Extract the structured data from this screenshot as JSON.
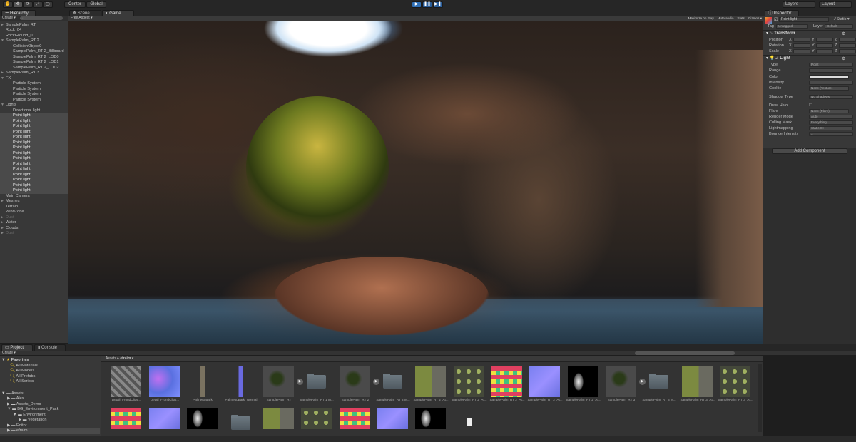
{
  "toolbar": {
    "tools": [
      "hand-tool",
      "move-tool",
      "rotate-tool",
      "scale-tool",
      "rect-tool"
    ],
    "pivot": "Center",
    "space": "Global",
    "play": "▶",
    "pause": "❚❚",
    "step": "▶❚",
    "layers": "Layers",
    "layout": "Layout"
  },
  "hierarchy": {
    "tab": "Hierarchy",
    "create": "Create ▾",
    "search_placeholder": "All",
    "items": [
      {
        "label": "SamplePalm_RT",
        "indent": 0,
        "arrow": true
      },
      {
        "label": "Rock_04",
        "indent": 0
      },
      {
        "label": "RockGround_01",
        "indent": 0
      },
      {
        "label": "SamplePalm_RT 2",
        "indent": 0,
        "arrow": true,
        "open": true
      },
      {
        "label": "CollisionObject0",
        "indent": 1
      },
      {
        "label": "SamplePalm_RT 2_Billboard",
        "indent": 1
      },
      {
        "label": "SamplePalm_RT 2_LOD0",
        "indent": 1
      },
      {
        "label": "SamplePalm_RT 2_LOD1",
        "indent": 1
      },
      {
        "label": "SamplePalm_RT 2_LOD2",
        "indent": 1
      },
      {
        "label": "SamplePalm_RT 3",
        "indent": 0,
        "arrow": true
      },
      {
        "label": "FX",
        "indent": 0,
        "arrow": true,
        "open": true
      },
      {
        "label": "Particle System",
        "indent": 1
      },
      {
        "label": "Particle System",
        "indent": 1
      },
      {
        "label": "Particle System",
        "indent": 1
      },
      {
        "label": "Particle System",
        "indent": 1
      },
      {
        "label": "Lights",
        "indent": 0,
        "arrow": true,
        "open": true
      },
      {
        "label": "Directional light",
        "indent": 1
      },
      {
        "label": "Point light",
        "indent": 1,
        "sel": true
      },
      {
        "label": "Point light",
        "indent": 1,
        "sel": true
      },
      {
        "label": "Point light",
        "indent": 1,
        "sel": true
      },
      {
        "label": "Point light",
        "indent": 1,
        "sel": true
      },
      {
        "label": "Point light",
        "indent": 1,
        "sel": true
      },
      {
        "label": "Point light",
        "indent": 1,
        "sel": true
      },
      {
        "label": "Point light",
        "indent": 1,
        "sel": true
      },
      {
        "label": "Point light",
        "indent": 1,
        "sel": true
      },
      {
        "label": "Point light",
        "indent": 1,
        "sel": true
      },
      {
        "label": "Point light",
        "indent": 1,
        "sel": true
      },
      {
        "label": "Point light",
        "indent": 1,
        "sel": true
      },
      {
        "label": "Point light",
        "indent": 1,
        "sel": true
      },
      {
        "label": "Point light",
        "indent": 1,
        "sel": true
      },
      {
        "label": "Point light",
        "indent": 1,
        "sel": true
      },
      {
        "label": "Point light",
        "indent": 1,
        "sel": true
      },
      {
        "label": "Main Camera",
        "indent": 0
      },
      {
        "label": "Meshes",
        "indent": 0,
        "arrow": true
      },
      {
        "label": "Terrain",
        "indent": 0
      },
      {
        "label": "WindZone",
        "indent": 0
      },
      {
        "label": "Dust",
        "indent": 0,
        "arrow": true,
        "dim": true
      },
      {
        "label": "Water",
        "indent": 0,
        "arrow": true
      },
      {
        "label": "Clouds",
        "indent": 0,
        "arrow": true
      },
      {
        "label": "Dust",
        "indent": 0,
        "arrow": true,
        "dim": true
      }
    ]
  },
  "view": {
    "tabs": [
      "Scene",
      "Game"
    ],
    "active": "Game",
    "aspect": "Free Aspect ▾",
    "options": [
      "Maximize on Play",
      "Mute audio",
      "Stats",
      "Gizmos ▾"
    ]
  },
  "inspector": {
    "tab": "Inspector",
    "object_name": "Point light",
    "static": "Static",
    "tag_label": "Tag",
    "tag": "Untagged",
    "layer_label": "Layer",
    "layer": "Default",
    "transform": {
      "title": "Transform",
      "rows": [
        "Position",
        "Rotation",
        "Scale"
      ],
      "axes": [
        "X",
        "Y",
        "Z"
      ]
    },
    "light": {
      "title": "Light",
      "rows": [
        {
          "label": "Type",
          "value": "Point",
          "kind": "select"
        },
        {
          "label": "Range",
          "value": "",
          "kind": "field"
        },
        {
          "label": "Color",
          "value": "",
          "kind": "color"
        },
        {
          "label": "Intensity",
          "value": "",
          "kind": "field"
        },
        {
          "label": "Cookie",
          "value": "None (Texture)",
          "kind": "object"
        },
        {
          "label": "Shadow Type",
          "value": "No Shadows",
          "kind": "select"
        },
        {
          "label": "Draw Halo",
          "value": "",
          "kind": "check"
        },
        {
          "label": "Flare",
          "value": "None (Flare)",
          "kind": "object"
        },
        {
          "label": "Render Mode",
          "value": "Auto",
          "kind": "select"
        },
        {
          "label": "Culling Mask",
          "value": "Everything",
          "kind": "select"
        },
        {
          "label": "Lightmapping",
          "value": "Static GI",
          "kind": "select"
        },
        {
          "label": "Bounce Intensity",
          "value": "1",
          "kind": "field"
        }
      ]
    },
    "add_component": "Add Component"
  },
  "project": {
    "tabs": [
      "Project",
      "Console"
    ],
    "create": "Create ▾",
    "favorites": {
      "title": "Favorites",
      "items": [
        "All Materials",
        "All Models",
        "All Prefabs",
        "All Scripts"
      ]
    },
    "assets": {
      "title": "Assets",
      "items": [
        {
          "label": "Alex",
          "indent": 1
        },
        {
          "label": "Assets_Demo",
          "indent": 1
        },
        {
          "label": "BG_Environment_Pack",
          "indent": 1,
          "open": true
        },
        {
          "label": "Environment",
          "indent": 2,
          "open": true
        },
        {
          "label": "Vegetation",
          "indent": 3
        },
        {
          "label": "Editor",
          "indent": 1
        },
        {
          "label": "efraim",
          "indent": 1,
          "sel": true
        }
      ]
    },
    "breadcrumb": [
      "Assets",
      "efraim"
    ],
    "row1": [
      {
        "label": "Detail_FrondClips...",
        "type": "stone"
      },
      {
        "label": "Detail_FrondClips...",
        "type": "normal"
      },
      {
        "label": "PalmettoBark",
        "type": "bark"
      },
      {
        "label": "PalmettoBark_Normal",
        "type": "barknormal"
      },
      {
        "label": "SamplePalm_RT",
        "type": "palm",
        "play": true
      },
      {
        "label": "SamplePalm_RT 1 M...",
        "type": "folder"
      },
      {
        "label": "SamplePalm_RT 2",
        "type": "palm",
        "play": true
      },
      {
        "label": "SamplePalm_RT 2 M...",
        "type": "folder"
      },
      {
        "label": "SamplePalm_RT 2_At...",
        "type": "leaf"
      },
      {
        "label": "SamplePalm_RT 2_At...",
        "type": "clusters"
      },
      {
        "label": "SamplePalm_RT 2_At...",
        "type": "colorful"
      },
      {
        "label": "SamplePalm_RT 2_At...",
        "type": "normal2"
      },
      {
        "label": "SamplePalm_RT 2_At...",
        "type": "bw"
      },
      {
        "label": "SamplePalm_RT 3",
        "type": "palm",
        "play": true
      },
      {
        "label": "SamplePalm_RT 3 M...",
        "type": "folder"
      },
      {
        "label": "SamplePalm_RT 3_At...",
        "type": "leaf"
      },
      {
        "label": "SamplePalm_RT 3_At...",
        "type": "clusters"
      }
    ],
    "row2": [
      "colorful",
      "normal2",
      "bw",
      "folder",
      "leaf",
      "clusters",
      "colorful",
      "normal2",
      "bw",
      "file"
    ]
  },
  "colors": {
    "accent": "#2f6fb5",
    "panel": "#383838"
  }
}
